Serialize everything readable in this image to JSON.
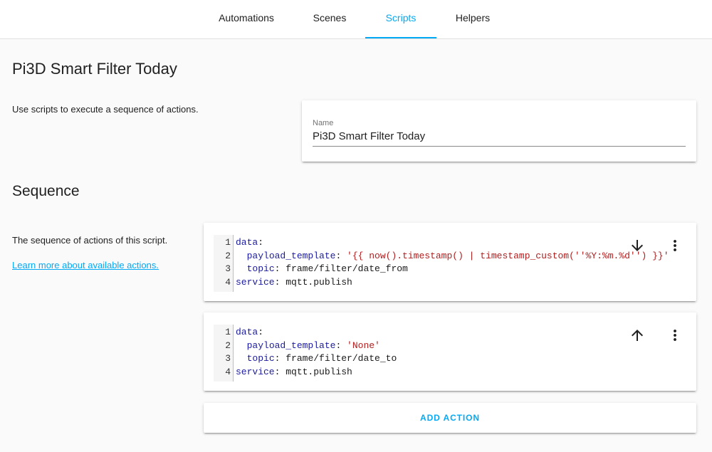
{
  "tabs": [
    {
      "label": "Automations"
    },
    {
      "label": "Scenes"
    },
    {
      "label": "Scripts",
      "active": true
    },
    {
      "label": "Helpers"
    }
  ],
  "page_title": "Pi3D Smart Filter Today",
  "intro_text": "Use scripts to execute a sequence of actions.",
  "name_field": {
    "label": "Name",
    "value": "Pi3D Smart Filter Today"
  },
  "sequence": {
    "title": "Sequence",
    "description": "The sequence of actions of this script.",
    "learn_more_link": "Learn more about available actions."
  },
  "actions": [
    {
      "move_icon": "arrow-down-icon",
      "lines": [
        {
          "num": "1",
          "key": "data",
          "sep": ":",
          "value": "",
          "indent": ""
        },
        {
          "num": "2",
          "key": "payload_template",
          "sep": ": ",
          "value": "'{{ now().timestamp() | timestamp_custom(''%Y:%m.%d'') }}'",
          "indent": "  ",
          "value_type": "str"
        },
        {
          "num": "3",
          "key": "topic",
          "sep": ": ",
          "value": "frame/filter/date_from",
          "indent": "  ",
          "value_type": "plain"
        },
        {
          "num": "4",
          "key": "service",
          "sep": ": ",
          "value": "mqtt.publish",
          "indent": "",
          "value_type": "plain"
        }
      ]
    },
    {
      "move_icon": "arrow-up-icon",
      "lines": [
        {
          "num": "1",
          "key": "data",
          "sep": ":",
          "value": "",
          "indent": ""
        },
        {
          "num": "2",
          "key": "payload_template",
          "sep": ": ",
          "value": "'None'",
          "indent": "  ",
          "value_type": "str"
        },
        {
          "num": "3",
          "key": "topic",
          "sep": ": ",
          "value": "frame/filter/date_to",
          "indent": "  ",
          "value_type": "plain"
        },
        {
          "num": "4",
          "key": "service",
          "sep": ": ",
          "value": "mqtt.publish",
          "indent": "",
          "value_type": "plain"
        }
      ]
    }
  ],
  "add_action_label": "ADD ACTION",
  "colors": {
    "accent": "#03a9f4",
    "yaml_key": "#1b1b9e",
    "yaml_string": "#b21d1d"
  }
}
